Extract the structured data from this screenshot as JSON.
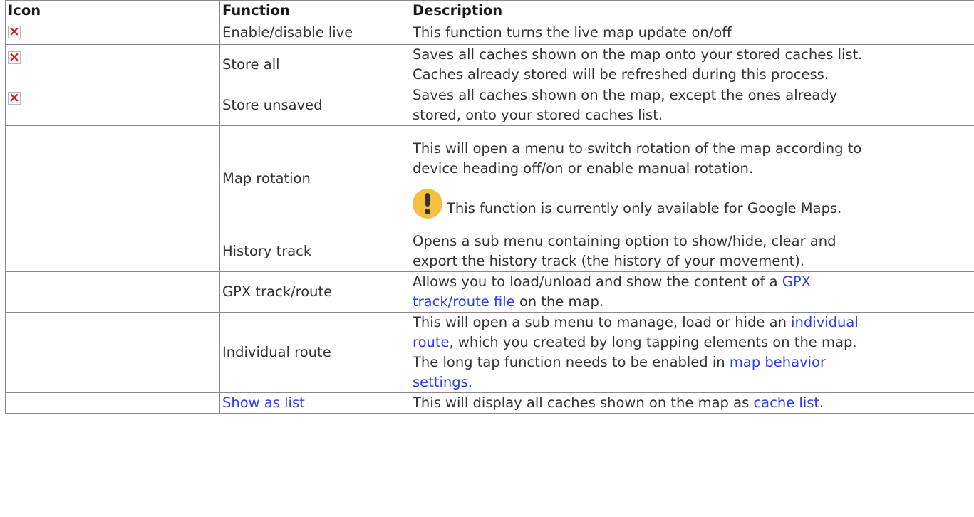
{
  "table": {
    "headers": {
      "icon": "Icon",
      "function": "Function",
      "description": "Description"
    },
    "rows": [
      {
        "icon": "broken-image",
        "function": "Enable/disable live",
        "description": "This function turns the live map update on/off"
      },
      {
        "icon": "broken-image",
        "function": "Store all",
        "description_line1": "Saves all caches shown on the map onto your stored caches list.",
        "description_line2": "Caches already stored will be refreshed during this process."
      },
      {
        "icon": "broken-image",
        "function": "Store unsaved",
        "description_line1": "Saves all caches shown on the map, except the ones already",
        "description_line2": "stored, onto your stored caches list."
      },
      {
        "function": "Map rotation",
        "description_line1": "This will open a menu to switch rotation of the map according to",
        "description_line2": "device heading off/on or enable manual rotation.",
        "note_icon": "warning-icon",
        "note": "This function is currently only available for Google Maps."
      },
      {
        "function": "History track",
        "description_line1": "Opens a sub menu containing option to show/hide, clear and",
        "description_line2": "export the history track (the history of your movement)."
      },
      {
        "function": "GPX track/route",
        "desc_before": "Allows you to load/unload and show the content of a ",
        "link1": "GPX",
        "link2": "track/route file",
        "desc_after": " on the map."
      },
      {
        "function": "Individual route",
        "desc_before": "This will open a sub menu to manage, load or hide an ",
        "link1": "individual",
        "link2": "route",
        "desc_mid": ", which you created by long tapping elements on the map.",
        "desc_line3": "The long tap function needs to be enabled in ",
        "link3": "map behavior",
        "link4": "settings",
        "desc_end": "."
      },
      {
        "function_link": "Show as list",
        "desc_before": "This will display all caches shown on the map as ",
        "link1": "cache list",
        "desc_after": "."
      }
    ]
  },
  "colors": {
    "link": "#2b3cf2",
    "border": "#8a8a8a",
    "warning": "#f5bf3f",
    "broken_image_x": "#cc1f1f"
  }
}
